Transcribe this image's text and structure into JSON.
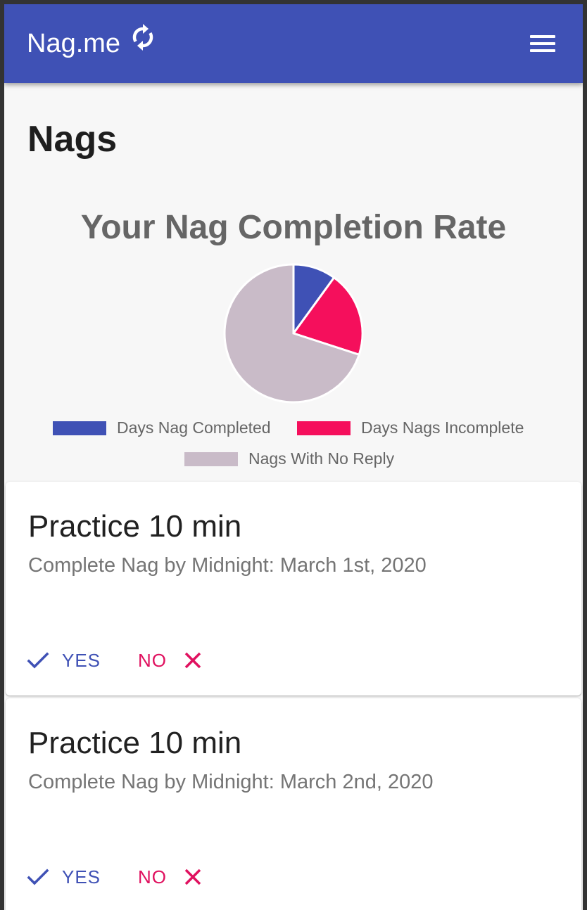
{
  "header": {
    "brand": "Nag.me",
    "brand_icon": "sync-icon",
    "menu_icon": "hamburger-menu-icon",
    "color": "#3f51b5"
  },
  "page": {
    "title": "Nags"
  },
  "chart_data": {
    "type": "pie",
    "title": "Your Nag Completion Rate",
    "legend_placement": "bottom",
    "categories": [
      "Days Nag Completed",
      "Days Nags Incomplete",
      "Nags With No Reply"
    ],
    "values": [
      1,
      2,
      7
    ],
    "colors": [
      "#3f51b5",
      "#f50f5c",
      "#c9bbc8"
    ]
  },
  "nags": [
    {
      "title": "Practice 10 min",
      "subtitle": "Complete Nag by Midnight: March 1st, 2020",
      "yes_label": "YES",
      "no_label": "NO"
    },
    {
      "title": "Practice 10 min",
      "subtitle": "Complete Nag by Midnight: March 2nd, 2020",
      "yes_label": "YES",
      "no_label": "NO"
    }
  ],
  "colors": {
    "yes": "#3f51b5",
    "no": "#e0115f"
  }
}
